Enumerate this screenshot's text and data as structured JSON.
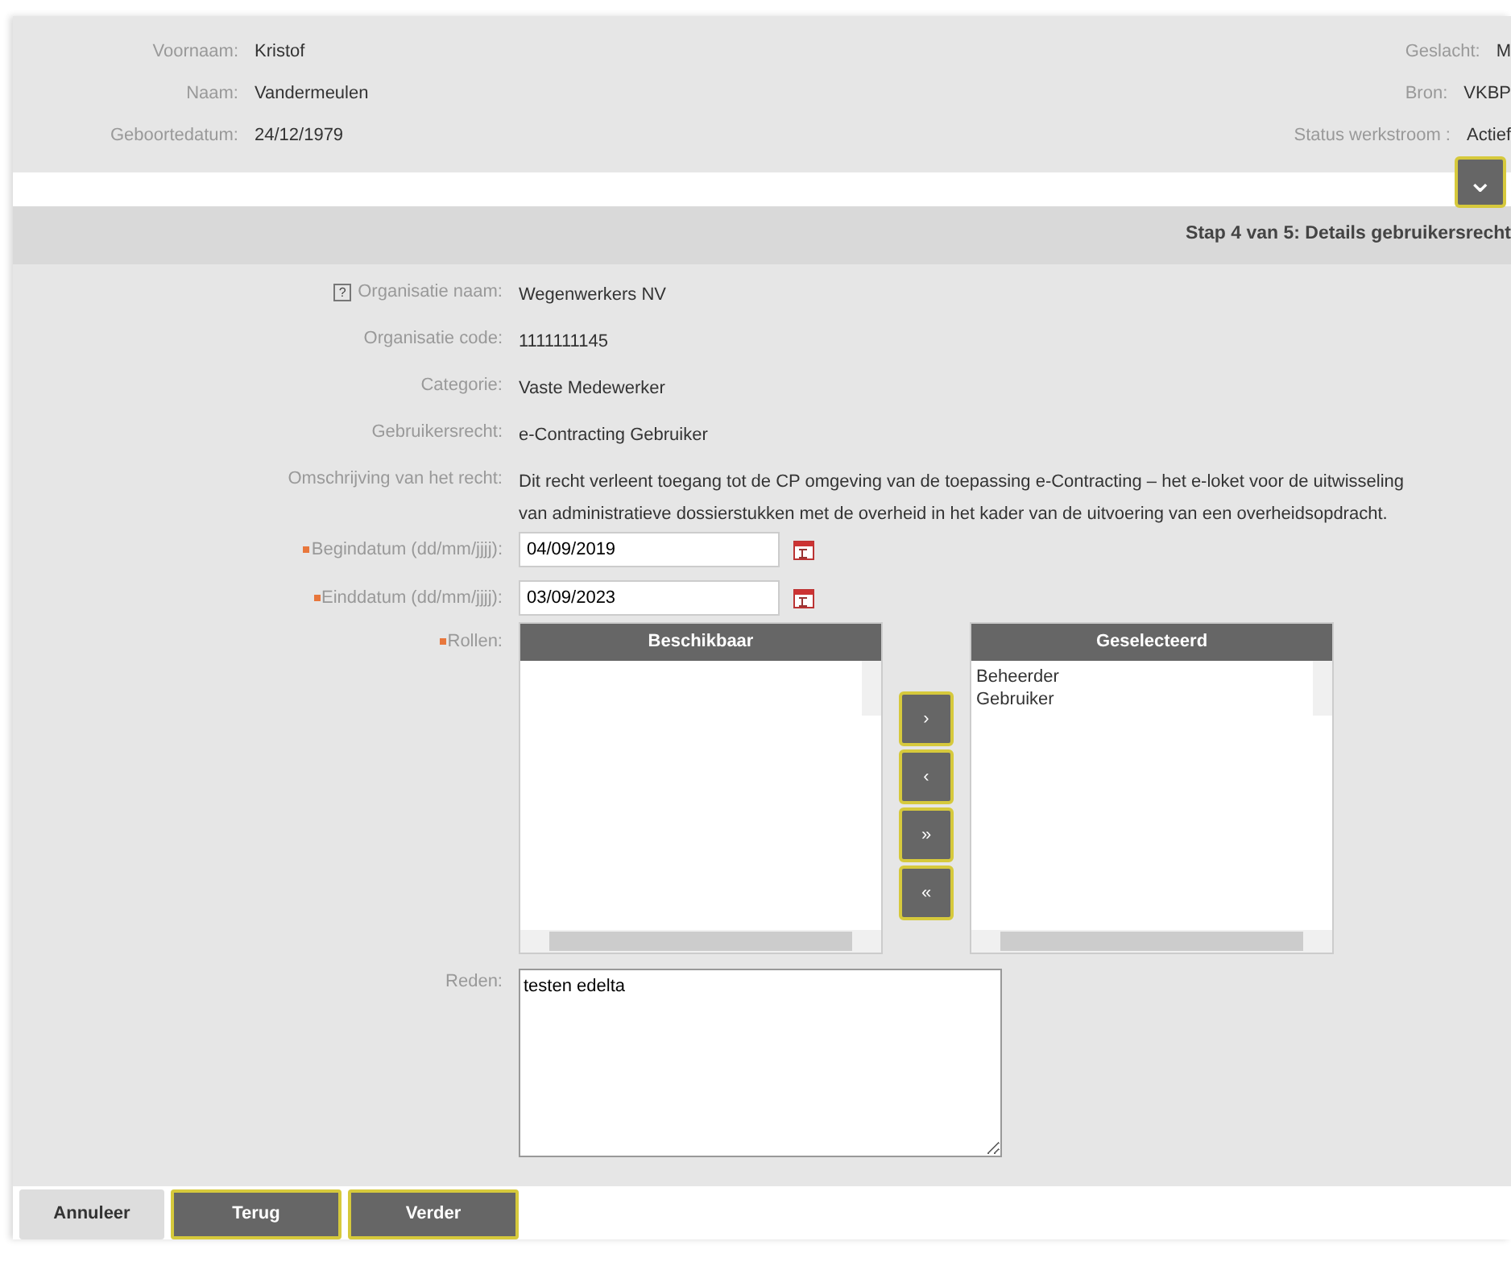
{
  "person": {
    "fields_left": [
      {
        "label": "Voornaam:",
        "value": "Kristof"
      },
      {
        "label": "Naam:",
        "value": "Vandermeulen"
      },
      {
        "label": "Geboortedatum:",
        "value": "24/12/1979"
      }
    ],
    "fields_right": [
      {
        "label": "Geslacht:",
        "value": "M"
      },
      {
        "label": "Bron:",
        "value": "VKBP"
      },
      {
        "label": "Status werkstroom :",
        "value": "Actief"
      }
    ],
    "expand_button": "⌄"
  },
  "step_title": "Stap 4 van 5: Details gebruikersrecht",
  "info": [
    {
      "label": "Organisatie naam:",
      "value": "Wegenwerkers NV",
      "help": "?"
    },
    {
      "label": "Organisatie code:",
      "value": "1111111145"
    },
    {
      "label": "Categorie:",
      "value": "Vaste Medewerker"
    },
    {
      "label": "Gebruikersrecht:",
      "value": "e-Contracting Gebruiker"
    },
    {
      "label": "Omschrijving van het recht:",
      "value": "Dit recht verleent toegang tot de CP omgeving van de toepassing e-Contracting – het e-loket voor de uitwisseling van administratieve dossierstukken met de overheid in het kader van de uitvoering van een overheidsopdracht."
    }
  ],
  "dates": [
    {
      "label": "Begindatum (dd/mm/jjjj):",
      "value": "04/09/2019",
      "required": true
    },
    {
      "label": "Einddatum (dd/mm/jjjj):",
      "value": "03/09/2023",
      "required": true
    }
  ],
  "roles": {
    "label": "Rollen:",
    "required": true,
    "available": {
      "title": "Beschikbaar"
    },
    "selected": {
      "title": "Geselecteerd",
      "items": [
        "Beheerder",
        "Gebruiker"
      ]
    },
    "move_buttons": [
      "›",
      "‹",
      "»",
      "«"
    ]
  },
  "reason": {
    "label": "Reden:",
    "value": "testen edelta"
  },
  "buttons": [
    {
      "label": "Annuleer",
      "kind": "secondary"
    },
    {
      "label": "Terug",
      "kind": "primary"
    },
    {
      "label": "Verder",
      "kind": "primary"
    }
  ]
}
